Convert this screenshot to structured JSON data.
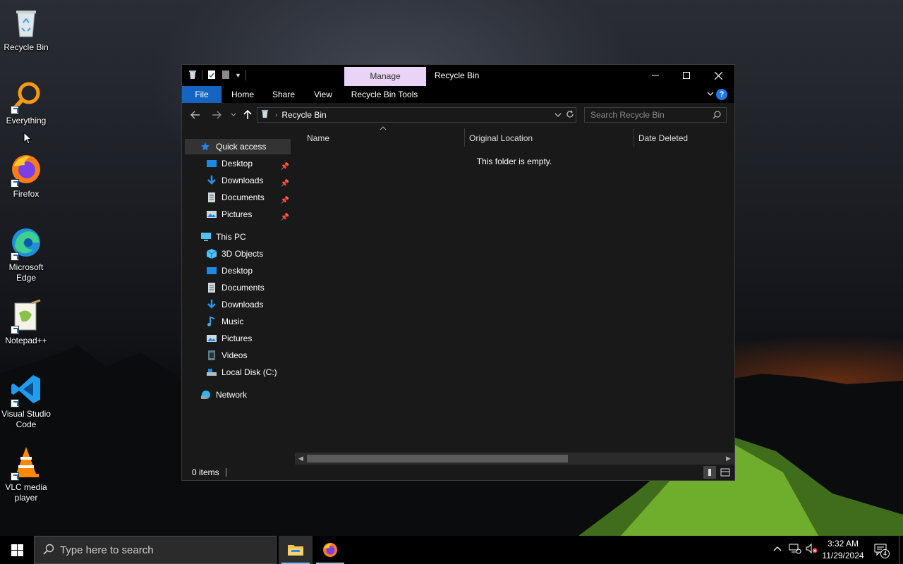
{
  "desktop": {
    "icons": [
      {
        "label": "Recycle Bin",
        "icon": "recycle-bin-icon"
      },
      {
        "label": "Everything",
        "icon": "everything-icon"
      },
      {
        "label": "Firefox",
        "icon": "firefox-icon"
      },
      {
        "label": "Microsoft Edge",
        "icon": "edge-icon"
      },
      {
        "label": "Notepad++",
        "icon": "notepadpp-icon"
      },
      {
        "label": "Visual Studio Code",
        "icon": "vscode-icon"
      },
      {
        "label": "VLC media player",
        "icon": "vlc-icon"
      }
    ]
  },
  "window": {
    "title": "Recycle Bin",
    "contextual_tab_group": "Manage",
    "ribbon_tabs": [
      "File",
      "Home",
      "Share",
      "View",
      "Recycle Bin Tools"
    ],
    "address": {
      "crumb": "Recycle Bin"
    },
    "search_placeholder": "Search Recycle Bin",
    "nav": {
      "quick_access": "Quick access",
      "quick_items": [
        {
          "label": "Desktop",
          "icon": "desktop-folder-icon",
          "pinned": true
        },
        {
          "label": "Downloads",
          "icon": "downloads-folder-icon",
          "pinned": true
        },
        {
          "label": "Documents",
          "icon": "documents-folder-icon",
          "pinned": true
        },
        {
          "label": "Pictures",
          "icon": "pictures-folder-icon",
          "pinned": true
        }
      ],
      "this_pc": "This PC",
      "pc_items": [
        {
          "label": "3D Objects",
          "icon": "3d-objects-icon"
        },
        {
          "label": "Desktop",
          "icon": "desktop-folder-icon"
        },
        {
          "label": "Documents",
          "icon": "documents-folder-icon"
        },
        {
          "label": "Downloads",
          "icon": "downloads-folder-icon"
        },
        {
          "label": "Music",
          "icon": "music-folder-icon"
        },
        {
          "label": "Pictures",
          "icon": "pictures-folder-icon"
        },
        {
          "label": "Videos",
          "icon": "videos-folder-icon"
        },
        {
          "label": "Local Disk (C:)",
          "icon": "local-disk-icon"
        }
      ],
      "network": "Network"
    },
    "columns": [
      "Name",
      "Original Location",
      "Date Deleted"
    ],
    "empty_message": "This folder is empty.",
    "status": {
      "items": "0 items"
    }
  },
  "taskbar": {
    "search_placeholder": "Type here to search",
    "time": "3:32 AM",
    "date": "11/29/2024",
    "notification_count": "4"
  },
  "colors": {
    "accent": "#1565c0",
    "manage_tab": "#e9d3f6",
    "window_bg": "#191919",
    "taskbar_bg": "#000000"
  }
}
